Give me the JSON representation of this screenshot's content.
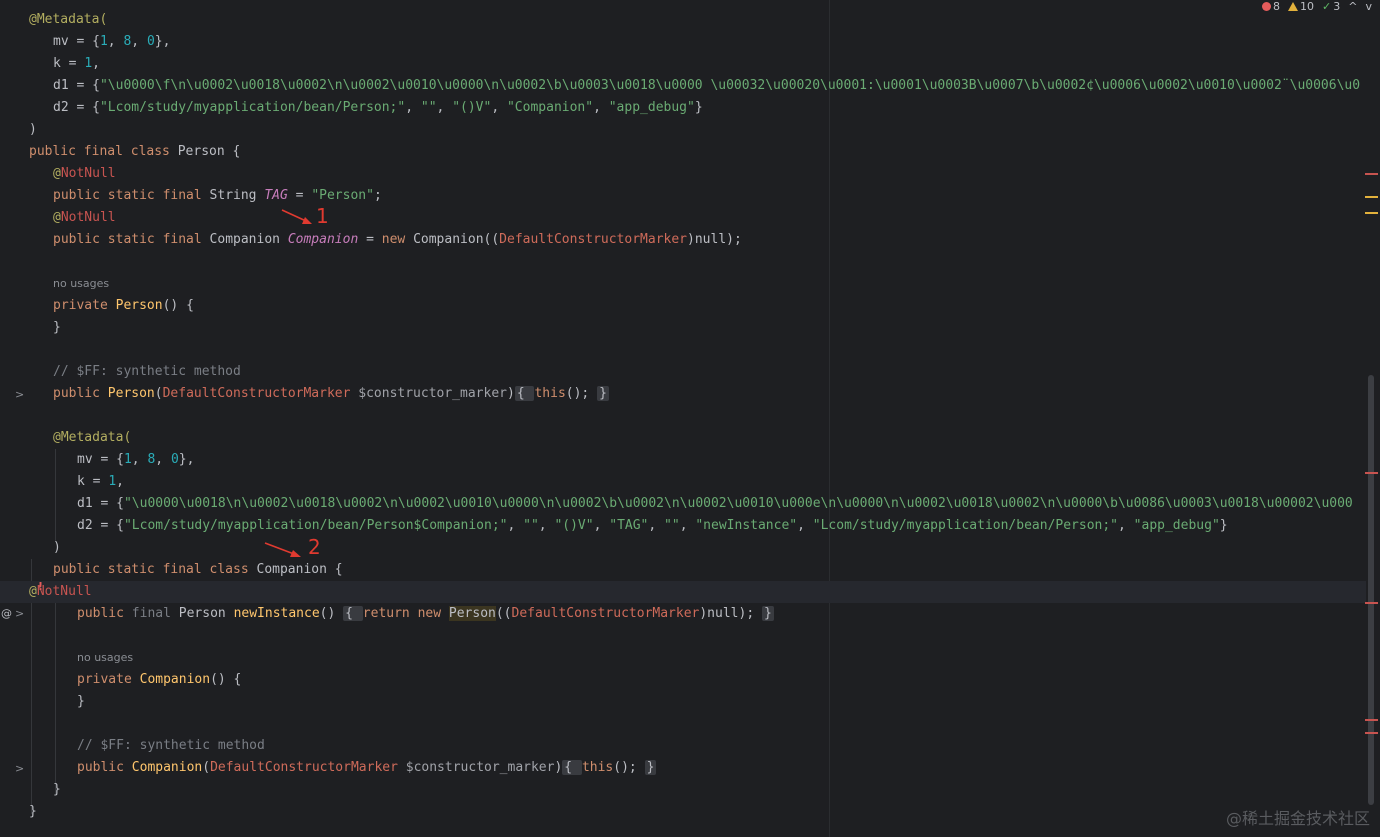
{
  "status": {
    "errors": "8",
    "warnings": "10",
    "weak": "3",
    "up": "^",
    "down": "v"
  },
  "annotations": {
    "one": "1",
    "two": "2"
  },
  "gutter": {
    "at": "@",
    "chev": ">",
    "bulb": "!"
  },
  "code": {
    "l1": "@Metadata(",
    "l2a": "mv = {",
    "l2n1": "1",
    "l2c1": ", ",
    "l2n2": "8",
    "l2c2": ", ",
    "l2n3": "0",
    "l2e": "},",
    "l3a": "k = ",
    "l3n": "1",
    "l3e": ",",
    "l4a": "d1 = {",
    "l4s": "\"\\u0000\\f\\n\\u0002\\u0018\\u0002\\n\\u0002\\u0010\\u0000\\n\\u0002\\b\\u0003\\u0018\\u0000 \\u00032\\u00020\\u0001:\\u0001\\u0003B\\u0007\\b\\u0002¢\\u0006\\u0002\\u0010\\u0002¨\\u0006\\u0",
    "l5a": "d2 = {",
    "l5s1": "\"Lcom/study/myapplication/bean/Person;\"",
    "l5c": ", ",
    "l5s2": "\"\"",
    "l5s3": "\"()V\"",
    "l5s4": "\"Companion\"",
    "l5s5": "\"app_debug\"",
    "l5e": "}",
    "l6": ")",
    "l7k": "public final class ",
    "l7c": "Person",
    "l7e": " {",
    "ann_at": "@",
    "ann_nn": "NotNull",
    "l9k": "public static final ",
    "l9t": "String ",
    "l9f": "TAG",
    "l9eq": " = ",
    "l9s": "\"Person\"",
    "l9e": ";",
    "l11k": "public static final ",
    "l11t": "Companion ",
    "l11f": "Companion",
    "l11eq": " = ",
    "l11n": "new ",
    "l11c": "Companion((",
    "l11d": "DefaultConstructorMarker",
    "l11e": ")null);",
    "hint_no_usages": "no usages",
    "l14k": "private ",
    "l14m": "Person",
    "l14e": "() {",
    "close": "}",
    "cmt": "// $FF: synthetic method",
    "l18k": "public ",
    "l18m": "Person",
    "l18p": "(",
    "l18d": "DefaultConstructorMarker",
    "l18v": " $constructor_marker",
    "l18c": ")",
    "l18b1": "{ ",
    "l18t": "this",
    "l18e": "(); ",
    "l18b2": "}",
    "l20": "@Metadata(",
    "l23s": "\"\\u0000\\u0018\\n\\u0002\\u0018\\u0002\\n\\u0002\\u0010\\u0000\\n\\u0002\\b\\u0002\\n\\u0002\\u0010\\u000e\\n\\u0000\\n\\u0002\\u0018\\u0002\\n\\u0000\\b\\u0086\\u0003\\u0018\\u00002\\u000",
    "l24s1": "\"Lcom/study/myapplication/bean/Person$Companion;\"",
    "l24s2": "\"\"",
    "l24s3": "\"()V\"",
    "l24s4": "\"TAG\"",
    "l24s5": "\"\"",
    "l24s6": "\"newInstance\"",
    "l24s7": "\"Lcom/study/myapplication/bean/Person;\"",
    "l24s8": "\"app_debug\"",
    "l26k": "public static final class ",
    "l26c": "Companion",
    "l26e": " {",
    "l28k": "public ",
    "l28f": "final ",
    "l28t": "Person ",
    "l28m": "newInstance",
    "l28p": "() ",
    "l28b1": "{ ",
    "l28r": "return new ",
    "l28c": "Person",
    "l28o": "((",
    "l28d": "DefaultConstructorMarker",
    "l28e": ")null); ",
    "l28b2": "}",
    "l31k": "private ",
    "l31m": "Companion",
    "l31e": "() {",
    "l35k": "public ",
    "l35m": "Companion",
    "l35p": "(",
    "l35d": "DefaultConstructorMarker",
    "l35v": " $constructor_marker",
    "l35c": ")",
    "l35b1": "{ ",
    "l35t": "this",
    "l35e": "(); ",
    "l35b2": "}"
  },
  "watermark": "@稀土掘金技术社区",
  "colors": {
    "error": "#e55b5b",
    "warning": "#e2b13c",
    "arrow": "#e03a30"
  }
}
